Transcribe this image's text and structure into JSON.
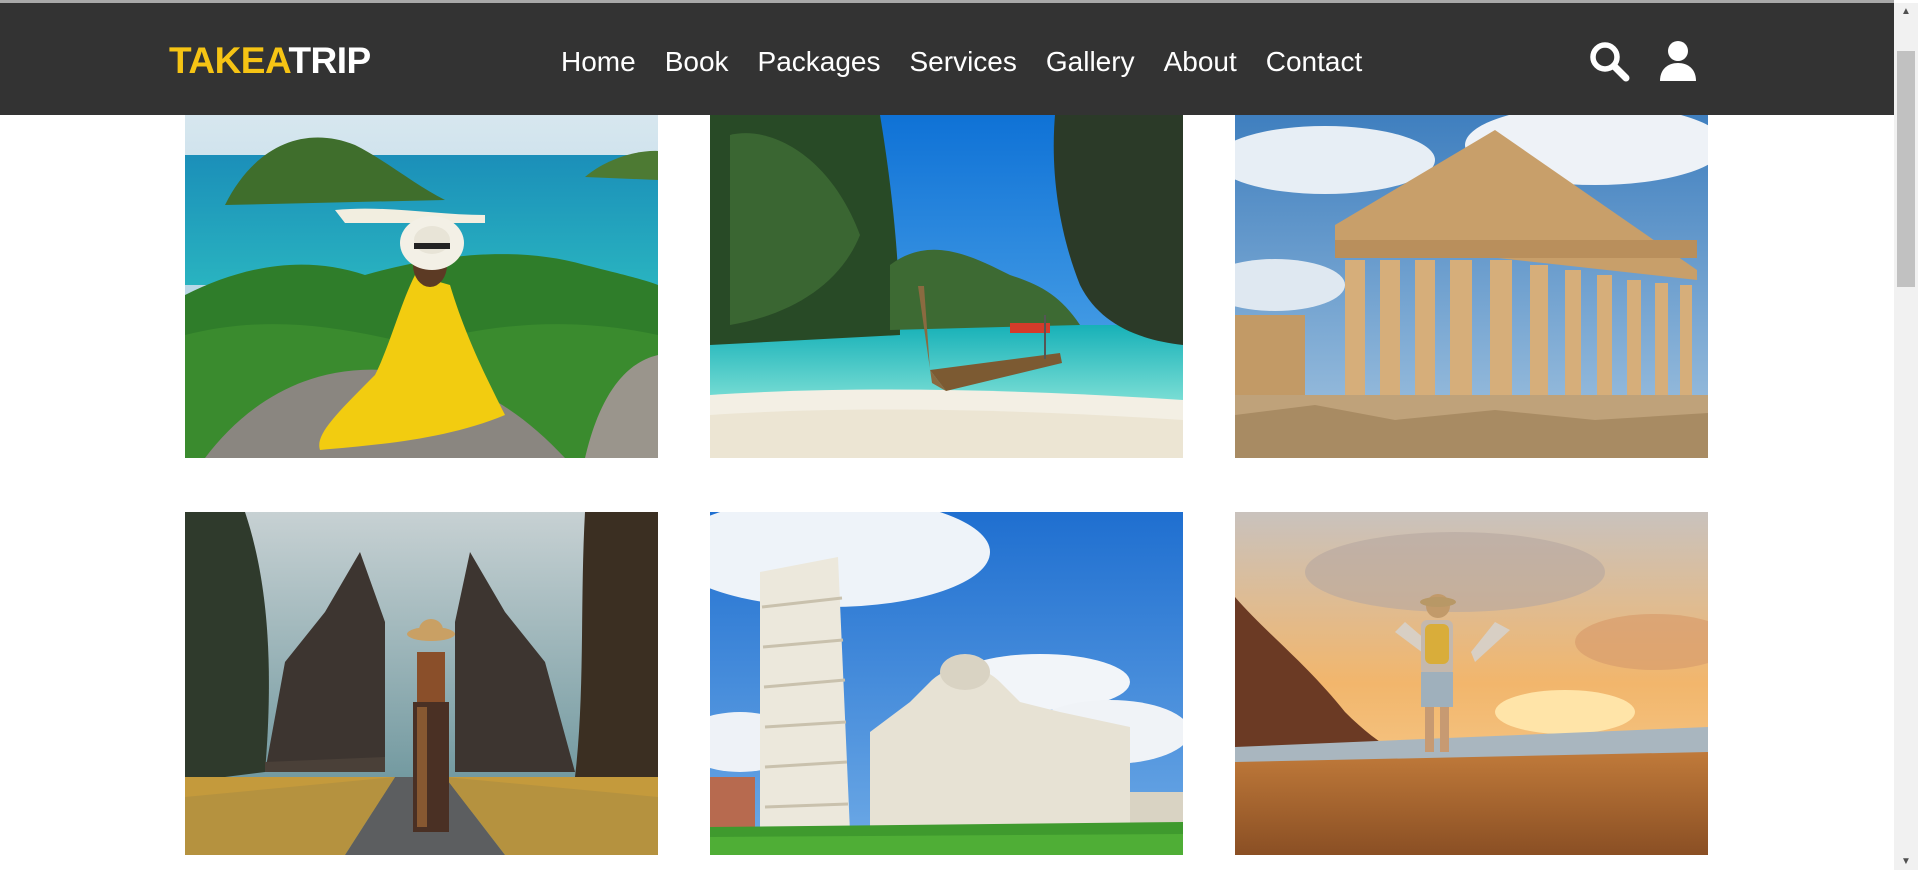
{
  "brand": {
    "part1": "TAKEA",
    "part2": "TRIP"
  },
  "nav": {
    "links": [
      "Home",
      "Book",
      "Packages",
      "Services",
      "Gallery",
      "About",
      "Contact"
    ],
    "icons": [
      "search-icon",
      "user-icon"
    ]
  },
  "colors": {
    "nav_bg": "#333333",
    "brand_accent": "#f6c414",
    "text_light": "#ffffff"
  },
  "gallery": {
    "images": [
      "woman-yellow-dress-island-view",
      "longtail-boat-tropical-beach",
      "parthenon-ruins",
      "temple-gate-traveler",
      "leaning-tower-pisa-cathedral",
      "hiker-sunset-beach"
    ]
  }
}
